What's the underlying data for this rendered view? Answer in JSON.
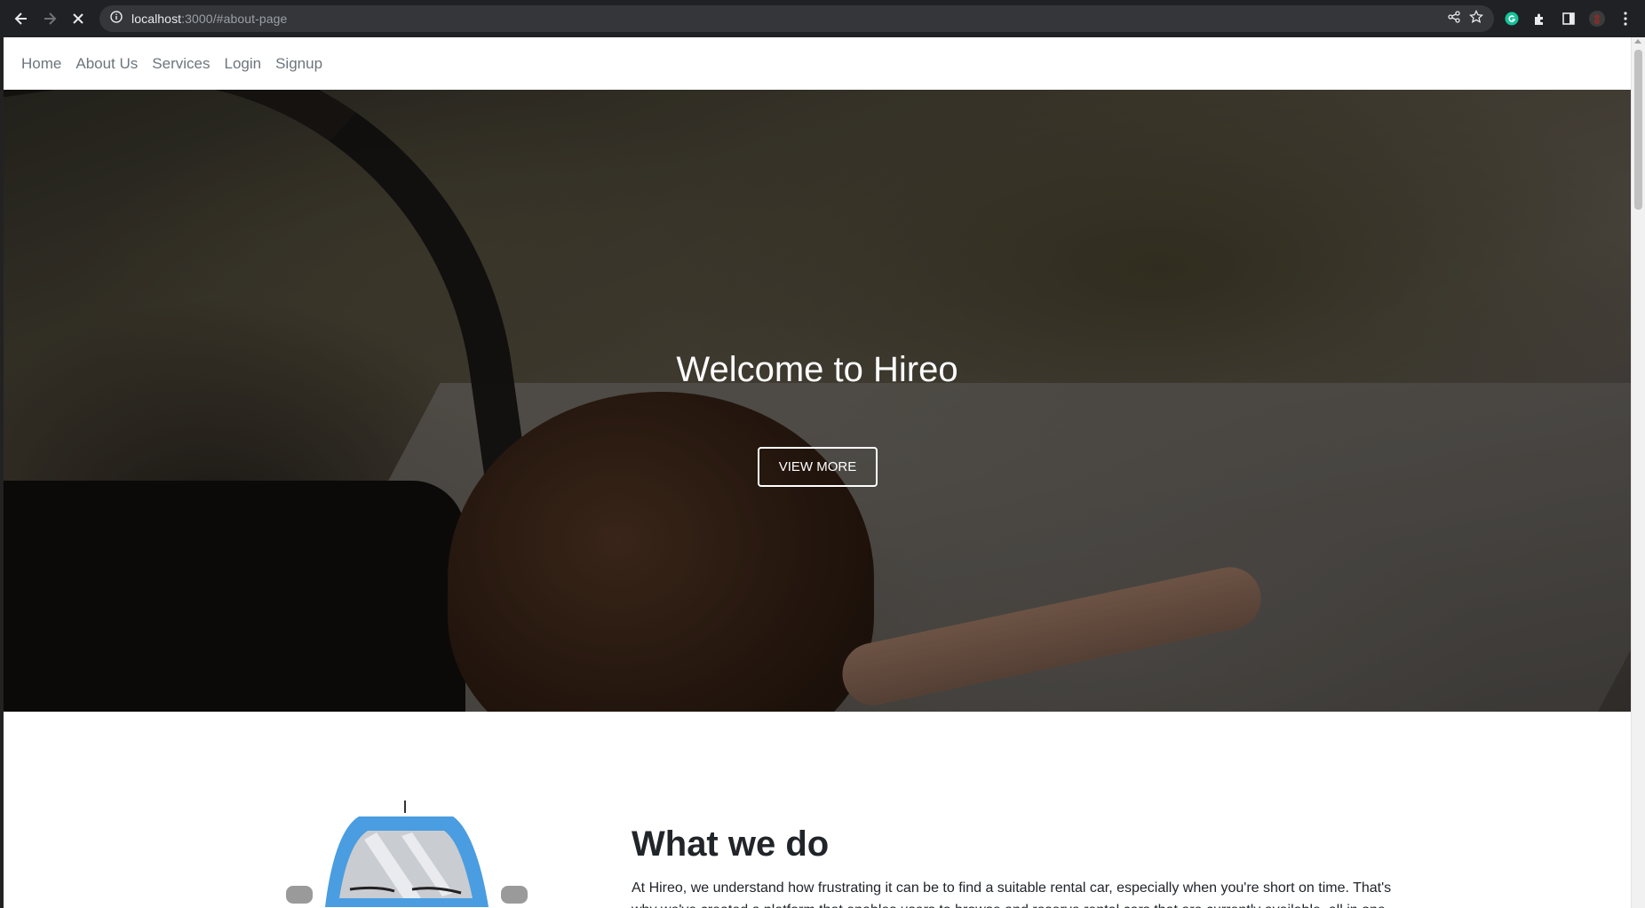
{
  "browser": {
    "url_host": "localhost",
    "url_path": ":3000/#about-page"
  },
  "nav": {
    "items": [
      "Home",
      "About Us",
      "Services",
      "Login",
      "Signup"
    ]
  },
  "hero": {
    "title": "Welcome to Hireo",
    "button_label": "VIEW MORE"
  },
  "about": {
    "heading": "What we do",
    "body": "At Hireo, we understand how frustrating it can be to find a suitable rental car, especially when you're short on time. That's why we've created a platform that enables users to browse and reserve rental cars that are currently available, all in one convenient place."
  },
  "colors": {
    "chrome_bg": "#202124",
    "omnibox_bg": "#35363a",
    "nav_text": "#6c757d",
    "heading_text": "#212529",
    "car_blue": "#4a9de0"
  }
}
